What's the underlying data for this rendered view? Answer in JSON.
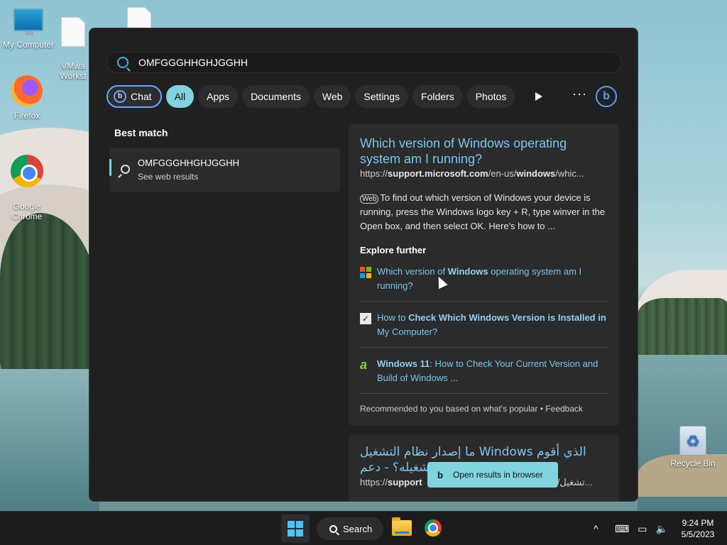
{
  "desktop": {
    "icons": [
      {
        "label": "My Computer"
      },
      {
        "label": "VMwa\nWorkst"
      },
      {
        "label": ""
      },
      {
        "label": "Firefox"
      },
      {
        "label": "Google\nChrome"
      },
      {
        "label": "Recycle Bin"
      }
    ]
  },
  "search": {
    "query": "OMFGGGHHGHJGGHH",
    "filters": [
      "Chat",
      "All",
      "Apps",
      "Documents",
      "Web",
      "Settings",
      "Folders",
      "Photos"
    ],
    "active_filter": "All",
    "more_label": "···",
    "best_match_label": "Best match",
    "best_match": {
      "title": "OMFGGGHHGHJGGHH",
      "subtitle": "See web results"
    },
    "result": {
      "title": "Which version of Windows operating system am I running?",
      "url_prefix": "https://",
      "url_bold1": "support.microsoft.com",
      "url_mid": "/en-us/",
      "url_bold2": "windows",
      "url_suffix": "/whic...",
      "web_tag": "Web",
      "snippet": "To find out which version of Windows your device is running, press the Windows logo key + R, type winver in the Open box, and then select OK. Here's how to ...",
      "explore_label": "Explore further",
      "explore": [
        {
          "pre": "Which version of ",
          "bold": "Windows",
          "post": " operating system am I running?"
        },
        {
          "pre": "How to ",
          "bold": "Check Which Windows Version is Installed in",
          "post": " My Computer?"
        },
        {
          "pre": "",
          "bold": "Windows 11",
          "post": ": How to Check Your Current Version and Build of Windows ..."
        }
      ],
      "recommended": "Recommended to you based on what's popular • Feedback"
    },
    "result2": {
      "title": "الذي أقوم Windows ما إصدار نظام التشغيل تشغيله؟ - دعم",
      "url_prefix": "https://",
      "url_bold": "support",
      "url_suffix": "dows/تشغيل..."
    },
    "open_in_browser": "Open results in browser"
  },
  "taskbar": {
    "search_label": "Search",
    "time": "9:24 PM",
    "date": "5/5/2023",
    "chevron": "^"
  },
  "colors": {
    "accent": "#7fd4e0",
    "link": "#7cc6ef",
    "panel_bg": "#202020",
    "card_bg": "#2b2b2b"
  }
}
